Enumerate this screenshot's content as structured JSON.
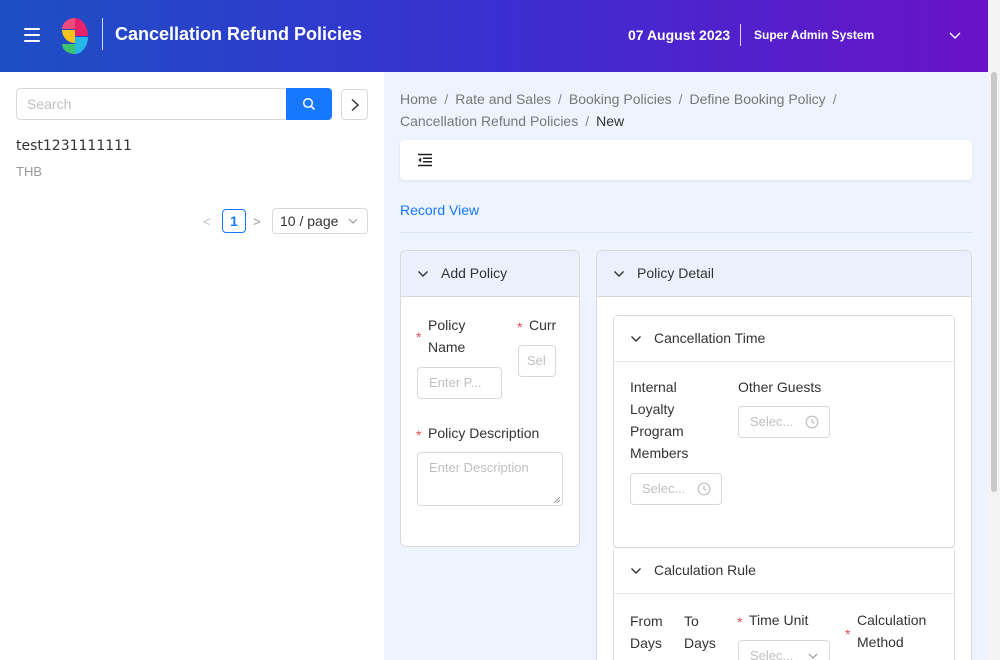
{
  "header": {
    "title": "Cancellation Refund Policies",
    "date": "07 August 2023",
    "user": "Super Admin System",
    "gradient_start": "#1d4fc4",
    "gradient_end": "#6a12c8"
  },
  "sidebar": {
    "search_placeholder": "Search",
    "items": [
      {
        "name": "test1231111111",
        "currency": "THB"
      }
    ],
    "pagination": {
      "current_page": "1",
      "page_size": "10 / page"
    }
  },
  "breadcrumb": {
    "items": [
      "Home",
      "Rate and Sales",
      "Booking Policies",
      "Define Booking Policy",
      "Cancellation Refund Policies"
    ],
    "current": "New"
  },
  "main": {
    "record_view_label": "Record View",
    "add_policy": {
      "title": "Add Policy",
      "policy_name_label": "Policy Name",
      "policy_name_placeholder": "Enter P...",
      "currency_label": "Curr",
      "currency_placeholder": "Sel",
      "policy_description_label": "Policy Description",
      "policy_description_placeholder": "Enter Description"
    },
    "policy_detail": {
      "title": "Policy Detail",
      "cancellation_time": {
        "title": "Cancellation Time",
        "loyalty_label": "Internal Loyalty Program Members",
        "loyalty_placeholder": "Selec...",
        "other_guests_label": "Other Guests",
        "other_guests_placeholder": "Selec..."
      },
      "calculation_rule": {
        "title": "Calculation Rule",
        "from_days_label": "From Days",
        "to_days_label": "To Days",
        "time_unit_label": "Time Unit",
        "time_unit_placeholder": "Selec...",
        "calculation_method_label": "Calculation Method"
      }
    }
  },
  "colors": {
    "accent": "#1677ff",
    "required": "#e34d59",
    "panel_bg": "#eef4fd"
  }
}
